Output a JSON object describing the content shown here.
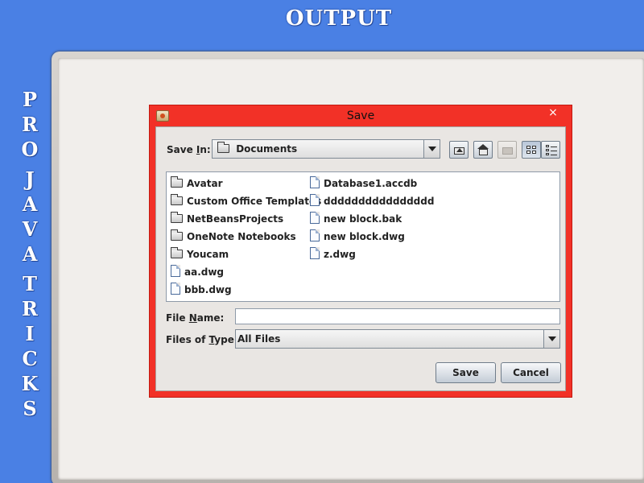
{
  "banner": {
    "title": "OUTPUT",
    "vertical_words": [
      "PRO",
      "JAVA",
      "TRICKS"
    ]
  },
  "dialog": {
    "title": "Save",
    "close_glyph": "×",
    "save_in": {
      "label_prefix": "Save ",
      "label_mnemonic": "I",
      "label_suffix": "n:",
      "value": "Documents"
    },
    "toolbar": {
      "up_icon": "up-one-level-icon",
      "home_icon": "home-icon",
      "new_folder_icon": "new-folder-icon",
      "list_icon": "list-view-icon",
      "details_icon": "details-view-icon"
    },
    "files": {
      "column1": [
        {
          "type": "folder",
          "name": "Avatar"
        },
        {
          "type": "folder",
          "name": "Custom Office Templates"
        },
        {
          "type": "folder",
          "name": "NetBeansProjects"
        },
        {
          "type": "folder",
          "name": "OneNote Notebooks"
        },
        {
          "type": "folder",
          "name": "Youcam"
        },
        {
          "type": "file",
          "name": "aa.dwg"
        },
        {
          "type": "file",
          "name": "bbb.dwg"
        }
      ],
      "column2": [
        {
          "type": "file",
          "name": "Database1.accdb"
        },
        {
          "type": "file",
          "name": "dddddddddddddddd"
        },
        {
          "type": "file",
          "name": "new block.bak"
        },
        {
          "type": "file",
          "name": "new block.dwg"
        },
        {
          "type": "file",
          "name": "z.dwg"
        }
      ]
    },
    "file_name": {
      "label_prefix": "File ",
      "label_mnemonic": "N",
      "label_suffix": "ame:",
      "value": ""
    },
    "file_type": {
      "label_prefix": "Files of ",
      "label_mnemonic": "T",
      "label_suffix": "ype:",
      "value": "All Files"
    },
    "buttons": {
      "save": "Save",
      "cancel": "Cancel"
    }
  },
  "colors": {
    "background": "#4a80e4",
    "dialog_border": "#f23127",
    "dialog_client": "#e9e6e3"
  }
}
